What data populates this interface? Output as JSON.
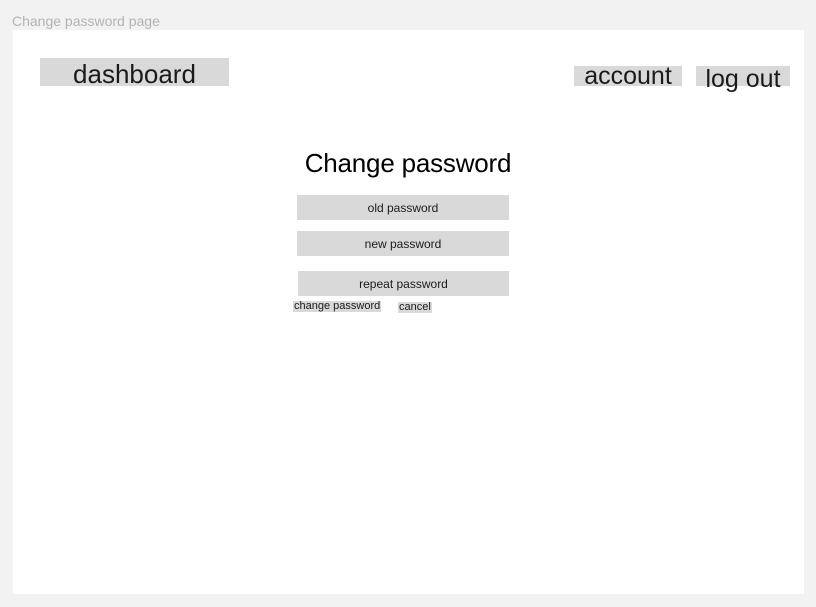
{
  "frame": {
    "label": "Change password page"
  },
  "nav": {
    "dashboard_label": "dashboard",
    "account_label": "account",
    "logout_label": "log out"
  },
  "form": {
    "title": "Change password",
    "old_password_placeholder": "old password",
    "new_password_placeholder": "new password",
    "repeat_password_placeholder": "repeat password",
    "submit_label": "change password",
    "cancel_label": "cancel"
  },
  "colors": {
    "canvas_background": "#f2f2f2",
    "frame_background": "#ffffff",
    "placeholder_fill": "#d9d9d9",
    "frame_label_text": "#b3b3b3",
    "text": "#1a1a1a"
  }
}
